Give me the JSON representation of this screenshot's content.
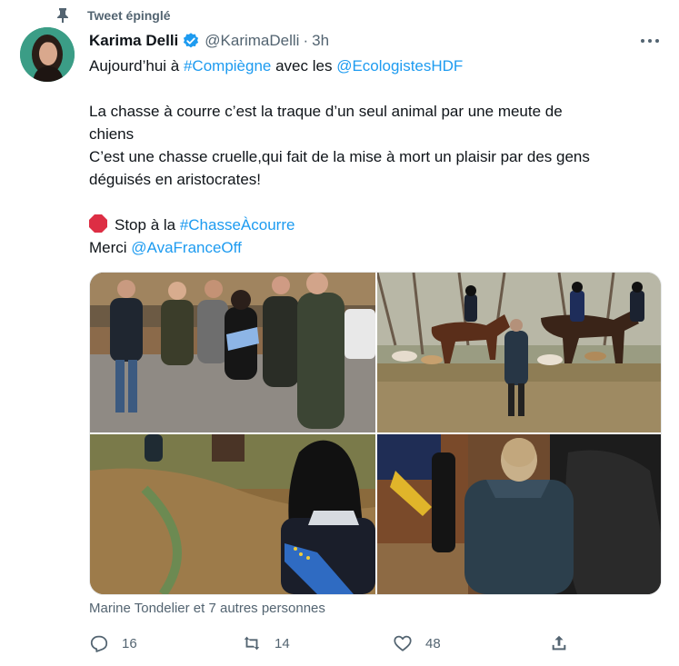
{
  "pinned": {
    "label": "Tweet épinglé",
    "icon": "pin-icon"
  },
  "author": {
    "name": "Karima Delli",
    "handle": "@KarimaDelli",
    "separator": "·",
    "time": "3h",
    "verified": true,
    "avatar_icon": "avatar"
  },
  "tweet": {
    "line1_prefix": "Aujourd’hui à ",
    "line1_hashtag": "#Compiègne",
    "line1_middle": " avec les ",
    "line1_mention": "@EcologistesHDF",
    "line2": "La chasse à courre c’est la traque d’un seul animal  par une meute de",
    "line3": "chiens",
    "line4": "C’est une chasse cruelle,qui fait de la mise à mort un plaisir par des gens",
    "line5": "déguisés en aristocrates!",
    "line6_emoji": "stop-sign-icon",
    "line6_prefix": "Stop à la ",
    "line6_hashtag": "#ChasseÀcourre",
    "line7_prefix": "Merci  ",
    "line7_mention": "@AvaFranceOff"
  },
  "media": [
    {
      "name": "photo-group-of-people-in-parking-lot"
    },
    {
      "name": "photo-riders-on-horses-with-hounds"
    },
    {
      "name": "photo-woman-with-eu-scarf-in-forest"
    },
    {
      "name": "photo-rider-boot-and-person-in-jacket"
    }
  ],
  "liked_by": "Marine Tondelier et 7 autres personnes",
  "actions": {
    "reply_count": "16",
    "retweet_count": "14",
    "like_count": "48"
  },
  "colors": {
    "link": "#1d9bf0",
    "secondary_text": "#536471",
    "verified": "#1d9bf0"
  }
}
